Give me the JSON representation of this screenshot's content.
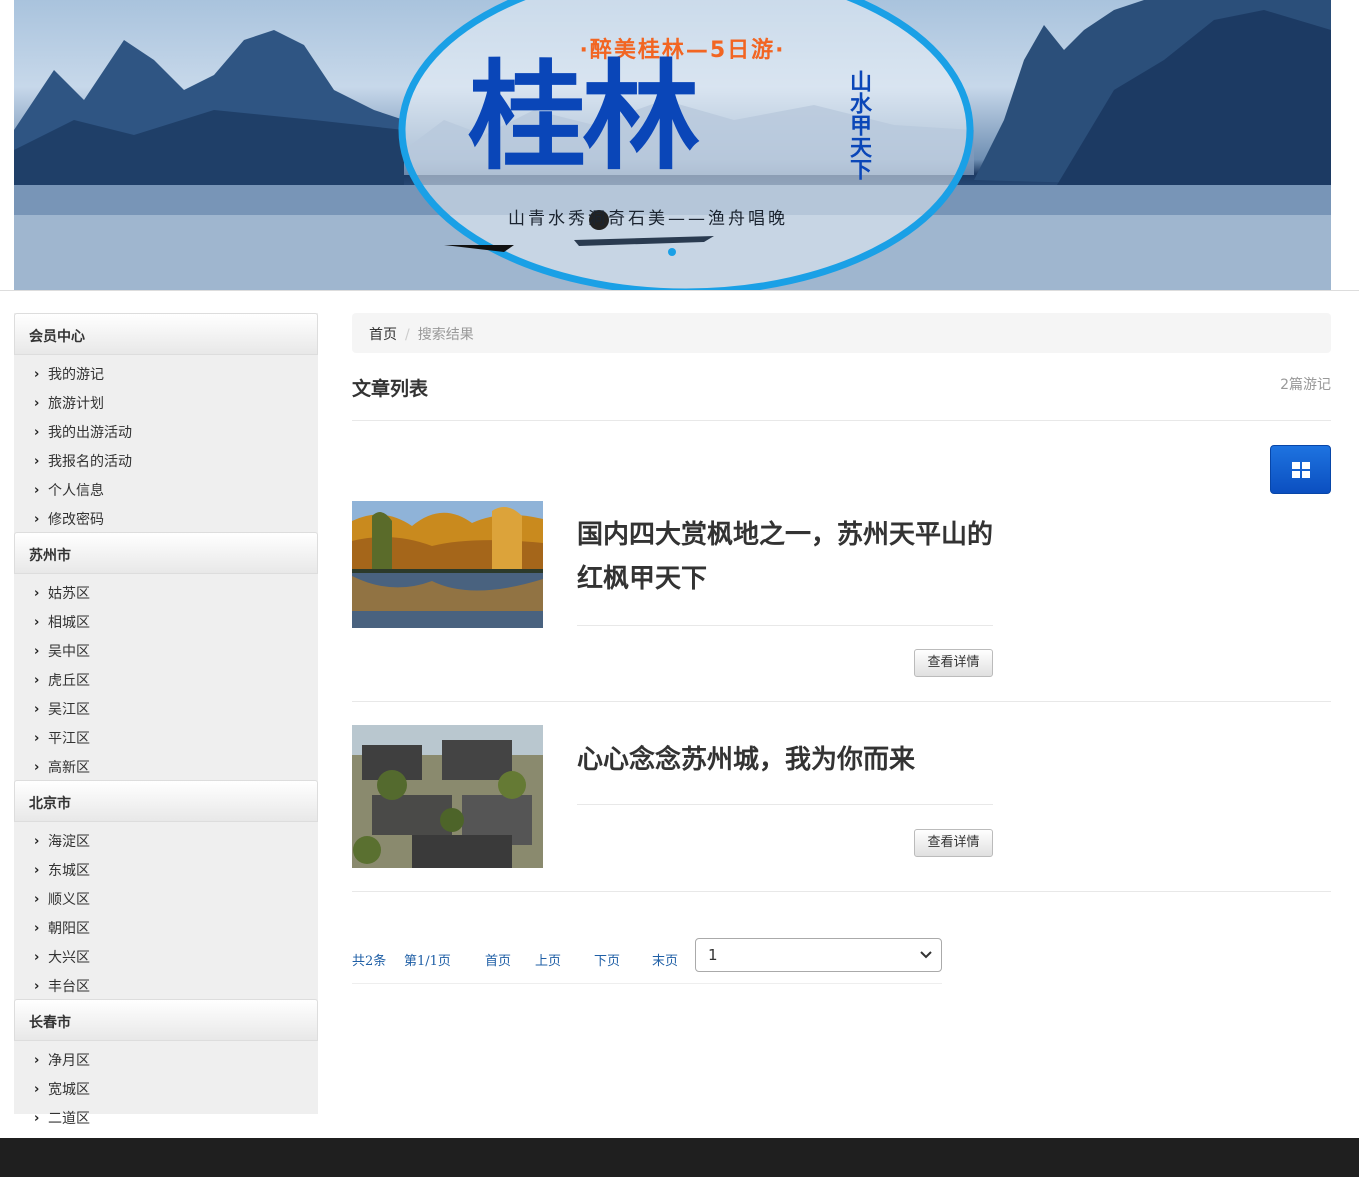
{
  "banner": {
    "subtitle": "·醉美桂林—5日游·",
    "title": "桂林",
    "vertical": "山水甲天下",
    "slogan": "山青水秀洞奇石美——渔舟唱晚"
  },
  "sidebar": {
    "groups": [
      {
        "title": "会员中心",
        "items": [
          "我的游记",
          "旅游计划",
          "我的出游活动",
          "我报名的活动",
          "个人信息",
          "修改密码"
        ]
      },
      {
        "title": "苏州市",
        "items": [
          "姑苏区",
          "相城区",
          "吴中区",
          "虎丘区",
          "吴江区",
          "平江区",
          "高新区"
        ]
      },
      {
        "title": "北京市",
        "items": [
          "海淀区",
          "东城区",
          "顺义区",
          "朝阳区",
          "大兴区",
          "丰台区"
        ]
      },
      {
        "title": "长春市",
        "items": [
          "净月区",
          "宽城区",
          "二道区"
        ]
      }
    ]
  },
  "breadcrumb": {
    "home": "首页",
    "separator": "/",
    "current": "搜索结果"
  },
  "list": {
    "title": "文章列表",
    "count": "2篇游记"
  },
  "articles": [
    {
      "title": "国内四大赏枫地之一，苏州天平山的红枫甲天下",
      "button": "查看详情"
    },
    {
      "title": "心心念念苏州城，我为你而来",
      "button": "查看详情"
    }
  ],
  "pager": {
    "total": "共2条",
    "page": "第1/1页",
    "first": "首页",
    "prev": "上页",
    "next": "下页",
    "last": "末页",
    "selected": "1"
  },
  "colors": {
    "accent": "#0b4fc0",
    "footer": "#1f1f1f"
  }
}
